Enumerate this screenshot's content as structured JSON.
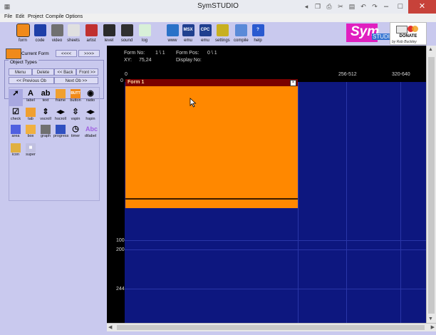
{
  "window": {
    "title": "SymSTUDIO"
  },
  "menu": [
    "File",
    "Edit",
    "Project",
    "Compile",
    "Options"
  ],
  "toolbar": [
    {
      "label": "form",
      "icon": "form-icon",
      "color": "#f08a1a"
    },
    {
      "label": "code",
      "icon": "code-icon",
      "color": "#1e3fa8"
    },
    {
      "label": "video",
      "icon": "video-icon",
      "color": "#707070"
    },
    {
      "label": "sheets",
      "icon": "sheets-icon",
      "color": "#e0e0e0"
    },
    {
      "label": "artist",
      "icon": "artist-icon",
      "color": "#c03030"
    },
    {
      "label": "level",
      "icon": "level-icon",
      "color": "#2b2b2b"
    },
    {
      "label": "sound",
      "icon": "sound-icon",
      "color": "#303030"
    },
    {
      "label": "log",
      "icon": "log-icon",
      "color": "#d8f0d8"
    },
    {
      "label": "www",
      "icon": "www-icon",
      "color": "#2a72c8"
    },
    {
      "label": "emu",
      "icon": "msx-emu-icon",
      "color": "#1f3f8f",
      "text": "MSX"
    },
    {
      "label": "emu",
      "icon": "cpc-emu-icon",
      "color": "#1f3f8f",
      "text": "CPC"
    },
    {
      "label": "settings",
      "icon": "settings-icon",
      "color": "#c8b020"
    },
    {
      "label": "compile",
      "icon": "compile-icon",
      "color": "#5a8ad8"
    },
    {
      "label": "help",
      "icon": "help-icon",
      "color": "#2a5ad0",
      "text": "?"
    }
  ],
  "logo": {
    "text": "Sym",
    "subtext": "STUDIO",
    "byline": "by Rob Buckley"
  },
  "donate": {
    "label": "DONATE"
  },
  "left_panel": {
    "current_form_label": "Current Form",
    "prev_form": "<<<<",
    "next_form": ">>>>",
    "object_types_label": "Object Types",
    "buttons": {
      "menu": "Menu",
      "delete": "Delete",
      "back": "<< Back",
      "front": "Front >>",
      "previous_obj": "<< Previous Ob",
      "next_obj": "Next Ob >>"
    },
    "objects": [
      {
        "label": "",
        "icon": "pointer-icon",
        "glyph": "➚"
      },
      {
        "label": "label",
        "icon": "label-icon",
        "glyph": "A"
      },
      {
        "label": "text",
        "icon": "text-icon",
        "glyph": "ab"
      },
      {
        "label": "frame",
        "icon": "frame-icon",
        "glyph": ""
      },
      {
        "label": "button",
        "icon": "button-icon",
        "glyph": "BUTT"
      },
      {
        "label": "radio",
        "icon": "radio-icon",
        "glyph": "◉"
      },
      {
        "label": "check",
        "icon": "check-icon",
        "glyph": "☑"
      },
      {
        "label": "tab",
        "icon": "tab-icon",
        "glyph": ""
      },
      {
        "label": "vscroll",
        "icon": "vscroll-icon",
        "glyph": "⇕"
      },
      {
        "label": "hscroll",
        "icon": "hscroll-icon",
        "glyph": "◂▸"
      },
      {
        "label": "vspin",
        "icon": "vspin-icon",
        "glyph": "⇳"
      },
      {
        "label": "hspin",
        "icon": "hspin-icon",
        "glyph": "◂▸"
      },
      {
        "label": "area",
        "icon": "area-icon",
        "glyph": ""
      },
      {
        "label": "box",
        "icon": "box-icon",
        "glyph": ""
      },
      {
        "label": "graph",
        "icon": "graph-icon",
        "glyph": ""
      },
      {
        "label": "progress",
        "icon": "progress-icon",
        "glyph": ""
      },
      {
        "label": "timer",
        "icon": "timer-icon",
        "glyph": "◷"
      },
      {
        "label": "dtlabel",
        "icon": "dtlabel-icon",
        "glyph": "Abc"
      },
      {
        "label": "icon",
        "icon": "icon-object-icon",
        "glyph": ""
      },
      {
        "label": "super",
        "icon": "super-icon",
        "glyph": "▦"
      }
    ]
  },
  "info": {
    "form_no_label": "Form No:",
    "form_no_value": "1 \\ 1",
    "form_pos_label": "Form Pos:",
    "form_pos_value": "0 \\ 1",
    "xy_label": "XY:",
    "xy_value": "75,24",
    "display_no_label": "Display No:"
  },
  "ruler": {
    "top": [
      "0",
      "256-512",
      "320-640"
    ],
    "left": [
      "0",
      "100",
      "200",
      "244"
    ]
  },
  "form": {
    "title": "Form 1",
    "color": "#ff8800",
    "title_bg": "#7a0000"
  },
  "colors": {
    "canvas_bg": "#0d177f",
    "panel_bg": "#c9c9ee"
  }
}
